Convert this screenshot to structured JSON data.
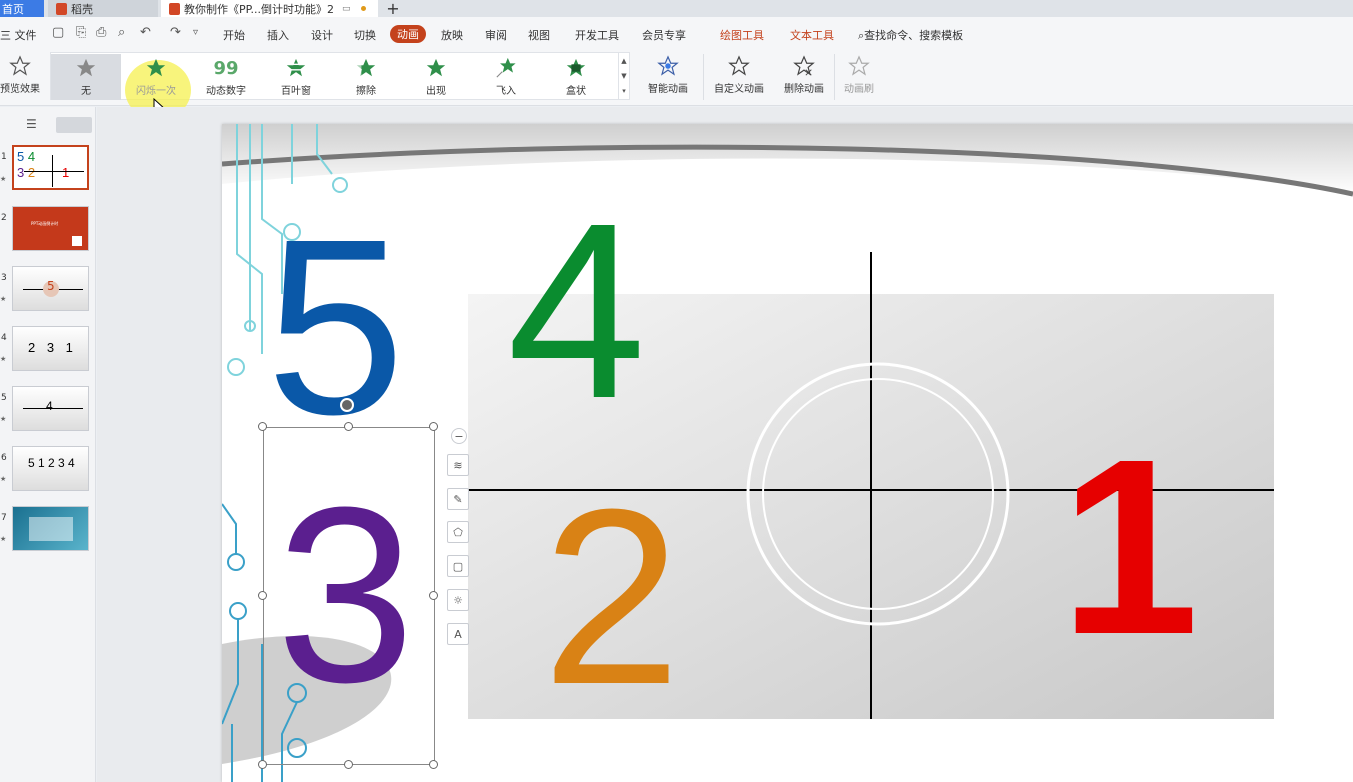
{
  "tabs": [
    {
      "label": "首页"
    },
    {
      "label": "稻壳"
    },
    {
      "label": "教你制作《PP...倒计时功能》2"
    }
  ],
  "menu": {
    "file": "三 文件",
    "items": [
      "开始",
      "插入",
      "设计",
      "切换",
      "动画",
      "放映",
      "审阅",
      "视图",
      "开发工具",
      "会员专享"
    ],
    "active": "动画",
    "context_tabs": [
      "绘图工具",
      "文本工具"
    ],
    "search": "查找命令、搜索模板"
  },
  "ribbon": {
    "preview": "预览效果",
    "gallery": [
      "无",
      "闪烁一次",
      "动态数字",
      "百叶窗",
      "擦除",
      "出现",
      "飞入",
      "盒状"
    ],
    "smart_animation": "智能动画",
    "custom_animation": "自定义动画",
    "delete_animation": "删除动画",
    "animation_brush": "动画刷"
  },
  "thumbnails": [
    {
      "num": "1",
      "text": "5 4 3 2 1"
    },
    {
      "num": "2",
      "text": "PPT动画倒计时"
    },
    {
      "num": "3",
      "text": "5"
    },
    {
      "num": "4",
      "text": "2 3 1"
    },
    {
      "num": "5",
      "text": "4"
    },
    {
      "num": "6",
      "text": "5 1 2 3 4"
    },
    {
      "num": "7",
      "text": ""
    }
  ],
  "slide": {
    "numbers": [
      {
        "value": "5",
        "color": "#0a58a8"
      },
      {
        "value": "4",
        "color": "#0a8c2f"
      },
      {
        "value": "3",
        "color": "#5b1f8f"
      },
      {
        "value": "2",
        "color": "#d98215"
      },
      {
        "value": "1",
        "color": "#e60000"
      }
    ]
  },
  "colors": {
    "accent": "#c4421c",
    "home_tab": "#3c7be5"
  }
}
